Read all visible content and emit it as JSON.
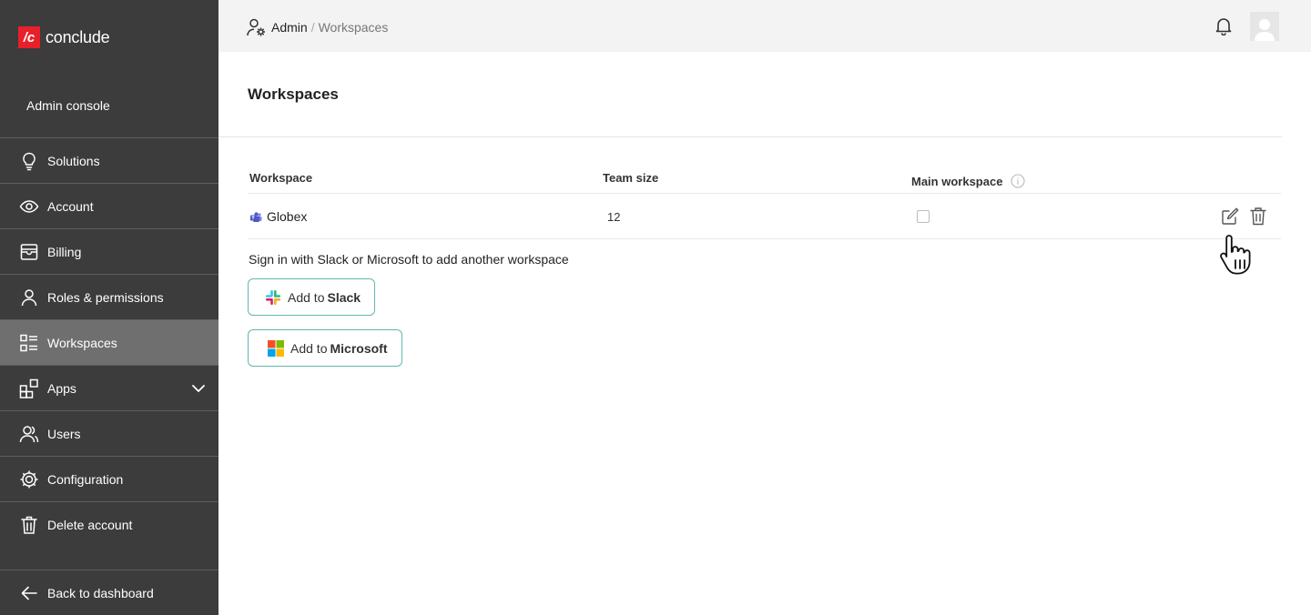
{
  "brand": {
    "logo_text": "/c",
    "name": "conclude",
    "accent": "#e8202a"
  },
  "sidebar": {
    "console_label": "Admin console",
    "items": [
      {
        "label": "Solutions",
        "icon": "lightbulb-icon"
      },
      {
        "label": "Account",
        "icon": "eye-icon"
      },
      {
        "label": "Billing",
        "icon": "billing-icon"
      },
      {
        "label": "Roles & permissions",
        "icon": "user-icon"
      },
      {
        "label": "Workspaces",
        "icon": "workspaces-icon",
        "active": true
      },
      {
        "label": "Apps",
        "icon": "apps-icon",
        "expandable": true
      },
      {
        "label": "Users",
        "icon": "users-icon"
      },
      {
        "label": "Configuration",
        "icon": "gear-icon"
      },
      {
        "label": "Delete account",
        "icon": "trash-icon"
      }
    ],
    "back_label": "Back to dashboard"
  },
  "topbar": {
    "breadcrumb_root": "Admin",
    "breadcrumb_separator": "/",
    "breadcrumb_current": "Workspaces"
  },
  "main": {
    "title": "Workspaces",
    "table": {
      "headers": {
        "workspace": "Workspace",
        "team_size": "Team size",
        "main_workspace": "Main workspace"
      },
      "rows": [
        {
          "workspace": "Globex",
          "team_size": "12",
          "main_workspace": false,
          "platform_icon": "teams-icon"
        }
      ]
    },
    "signin_text": "Sign in with Slack or Microsoft to add another workspace",
    "slack_button": {
      "prefix": "Add to",
      "brand": "Slack"
    },
    "microsoft_button": {
      "prefix": "Add to",
      "brand": "Microsoft"
    }
  },
  "colors": {
    "sidebar_bg": "#3c3c3c",
    "sidebar_active": "#6f6f6f",
    "topbar_bg": "#f3f3f3",
    "button_border": "#63b7ad"
  }
}
